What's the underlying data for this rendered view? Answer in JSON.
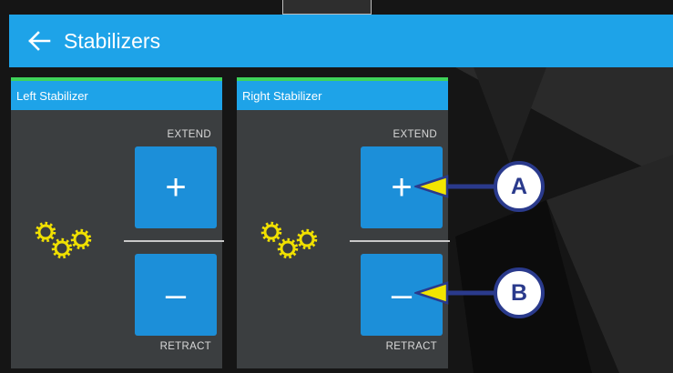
{
  "header": {
    "title": "Stabilizers"
  },
  "panels": [
    {
      "title": "Left Stabilizer",
      "extend_label": "EXTEND",
      "extend_symbol": "+",
      "retract_label": "RETRACT",
      "retract_symbol": "–"
    },
    {
      "title": "Right Stabilizer",
      "extend_label": "EXTEND",
      "extend_symbol": "+",
      "retract_label": "RETRACT",
      "retract_symbol": "–"
    }
  ],
  "callouts": {
    "a": "A",
    "b": "B"
  },
  "colors": {
    "header": "#1ea3e8",
    "button": "#1c8fd9",
    "panel": "#3b3e40",
    "gear": "#f0e000",
    "callout_arrow": "#f2e500",
    "callout_border": "#2a3a8c"
  }
}
